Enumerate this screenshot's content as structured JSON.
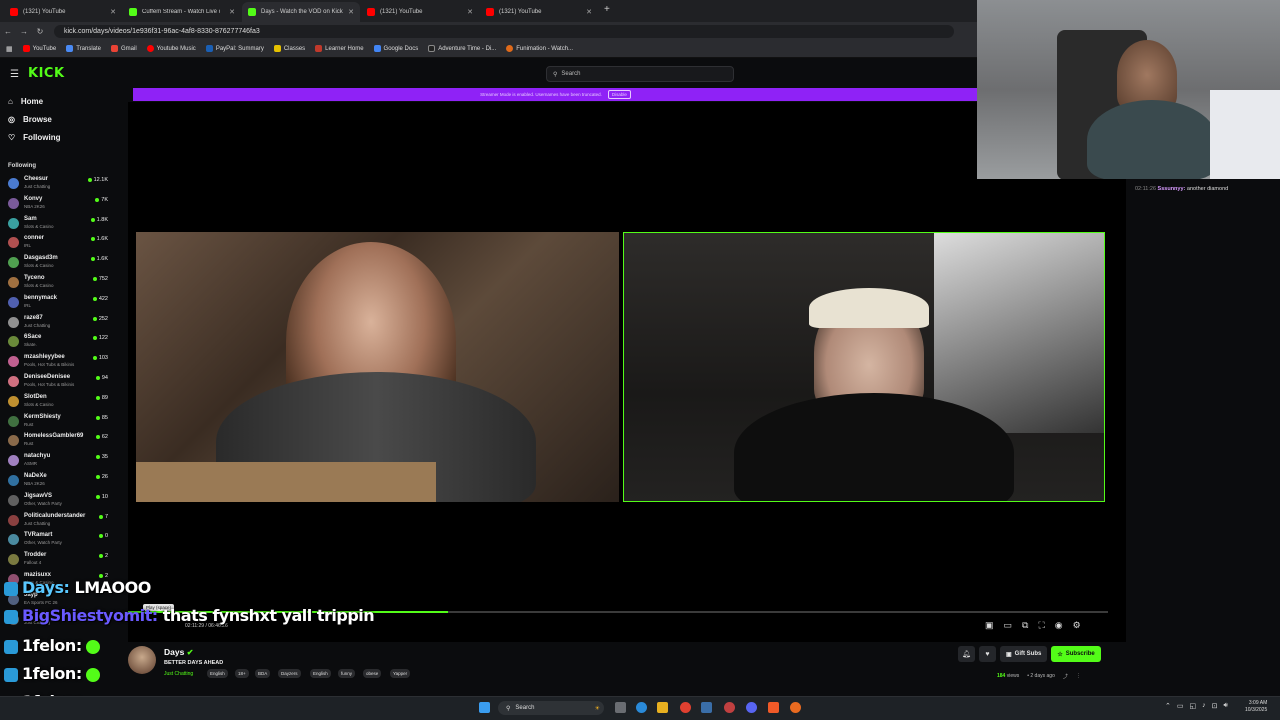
{
  "browser": {
    "tabs": [
      {
        "title": "(1321) YouTube",
        "color": "#ff0000"
      },
      {
        "title": "Cuffem Stream - Watch Live on Kick",
        "color": "#53fc18"
      },
      {
        "title": "Days - Watch the VOD on Kick",
        "color": "#53fc18"
      },
      {
        "title": "(1321) YouTube",
        "color": "#ff0000"
      },
      {
        "title": "(1321) YouTube",
        "color": "#ff0000"
      }
    ],
    "url": "kick.com/days/videos/1e936f31-96ac-4af8-8330-876277746fa3",
    "bookmarks": [
      "YouTube",
      "Translate",
      "Gmail",
      "Youtube Music",
      "PayPal: Summary",
      "Classes",
      "Learner Home",
      "Google Docs",
      "Adventure Time - Di...",
      "Funimation - Watch..."
    ]
  },
  "kick": {
    "logo": "KICK",
    "search_placeholder": "Search",
    "banner_text": "Streamer Mode is enabled. Usernames have been truncated.",
    "banner_button": "Disable",
    "nav": [
      {
        "label": "Home",
        "icon": "home-icon"
      },
      {
        "label": "Browse",
        "icon": "compass-icon"
      },
      {
        "label": "Following",
        "icon": "heart-icon"
      }
    ],
    "following_heading": "Following",
    "following": [
      {
        "name": "Cheesur",
        "category": "Just Chatting",
        "count": "12.1K",
        "color": "#4a7bd0"
      },
      {
        "name": "Konvy",
        "category": "NBA 2K26",
        "count": "7K",
        "color": "#7a5a9a"
      },
      {
        "name": "Sam",
        "category": "Slots & Casino",
        "count": "1.8K",
        "color": "#3aa0a0"
      },
      {
        "name": "conner",
        "category": "IRL",
        "count": "1.6K",
        "color": "#b05050"
      },
      {
        "name": "Dasgasd3m",
        "category": "Slots & Casino",
        "count": "1.6K",
        "color": "#50a050"
      },
      {
        "name": "Tyceno",
        "category": "Slots & Casino",
        "count": "752",
        "color": "#a07040"
      },
      {
        "name": "bennymack",
        "category": "IRL",
        "count": "422",
        "color": "#5060b0"
      },
      {
        "name": "raze87",
        "category": "Just Chatting",
        "count": "252",
        "color": "#909090"
      },
      {
        "name": "6Sace",
        "category": "Skate.",
        "count": "122",
        "color": "#6a8a3a"
      },
      {
        "name": "mzashleyybee",
        "category": "Pools, Hot Tubs & Bikinis",
        "count": "103",
        "color": "#c06090"
      },
      {
        "name": "DeniseeDenisee",
        "category": "Pools, Hot Tubs & Bikinis",
        "count": "94",
        "color": "#d07080"
      },
      {
        "name": "SlotDen",
        "category": "Slots & Casino",
        "count": "89",
        "color": "#c09030"
      },
      {
        "name": "KermShiesty",
        "category": "Rust",
        "count": "85",
        "color": "#407040"
      },
      {
        "name": "HomelessGambler69",
        "category": "Rust",
        "count": "62",
        "color": "#8a6a4a"
      },
      {
        "name": "natachyu",
        "category": "ASMR",
        "count": "35",
        "color": "#a080c0"
      },
      {
        "name": "NaDeXe",
        "category": "NBA 2K26",
        "count": "26",
        "color": "#3070a0"
      },
      {
        "name": "JigsawVS",
        "category": "Other, Watch Party",
        "count": "10",
        "color": "#606060"
      },
      {
        "name": "Politicalunderstander",
        "category": "Just Chatting",
        "count": "7",
        "color": "#8a4040"
      },
      {
        "name": "TVRamart",
        "category": "Other, Watch Party",
        "count": "0",
        "color": "#4a8aa0"
      },
      {
        "name": "Trodder",
        "category": "Fallout 4",
        "count": "2",
        "color": "#7a7a40"
      },
      {
        "name": "mazisuxx",
        "category": "Slots & Casino",
        "count": "2",
        "color": "#905070"
      },
      {
        "name": "Jayp",
        "category": "EA Sports FC 26",
        "count": "",
        "color": "#506080"
      },
      {
        "name": "",
        "category": "Just Chatting",
        "count": "",
        "color": "#606060"
      }
    ],
    "player": {
      "tooltip": "Play (space)",
      "timecode": "02:11:29 / 06:46:26"
    },
    "overlay_chat": [
      {
        "user": "Days:",
        "text": " LMAOOO",
        "badge_color": "#2a9ad8"
      },
      {
        "user": "BigShiestyomit:",
        "text": " thats fynshxt yall trippin",
        "badge_color": "#2a9ad8"
      },
      {
        "user": "1felon:",
        "text": "",
        "badge_color": "#2a9ad8"
      },
      {
        "user": "1felon:",
        "text": "",
        "badge_color": "#2a9ad8"
      },
      {
        "user": "1felon:",
        "text": "",
        "badge_color": "#2a9ad8"
      }
    ],
    "side_chat": {
      "time": "02:11:26",
      "user": "Sssunnyy:",
      "text": " another diamond"
    },
    "channel": {
      "name": "Days",
      "title": "BETTER DAYS AHEAD",
      "category": "Just Chatting",
      "tags": [
        "English",
        "18+",
        "BDA",
        "Dayzers",
        "English",
        "funny",
        "obese",
        "Yapper"
      ],
      "gift_label": "Gift Subs",
      "subscribe_label": "Subscribe",
      "views": "184",
      "views_label": "views",
      "age": "2 days ago"
    }
  },
  "taskbar": {
    "search_placeholder": "Search",
    "time": "3:09 AM",
    "date": "10/3/2025"
  }
}
